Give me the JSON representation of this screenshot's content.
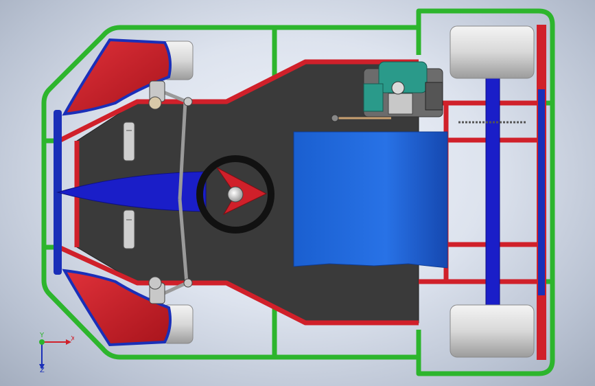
{
  "viewport": {
    "background": "gradient-grey",
    "model": "go-kart-top-view"
  },
  "colors": {
    "frame_green": "#2db52d",
    "rail_red": "#d0202a",
    "bumper_blue": "#1a2fb8",
    "floor_dark": "#3a3a3a",
    "seat_blue": "#1e64d6",
    "tire_grey": "#d6d6d6",
    "engine_teal": "#2a9a8a",
    "axle_blue": "#1a1ec8"
  },
  "triad": {
    "x_label": "X",
    "y_label": "Y",
    "z_label": "Z"
  },
  "icons": [
    "steering-wheel-icon",
    "engine-icon",
    "triad-icon"
  ]
}
